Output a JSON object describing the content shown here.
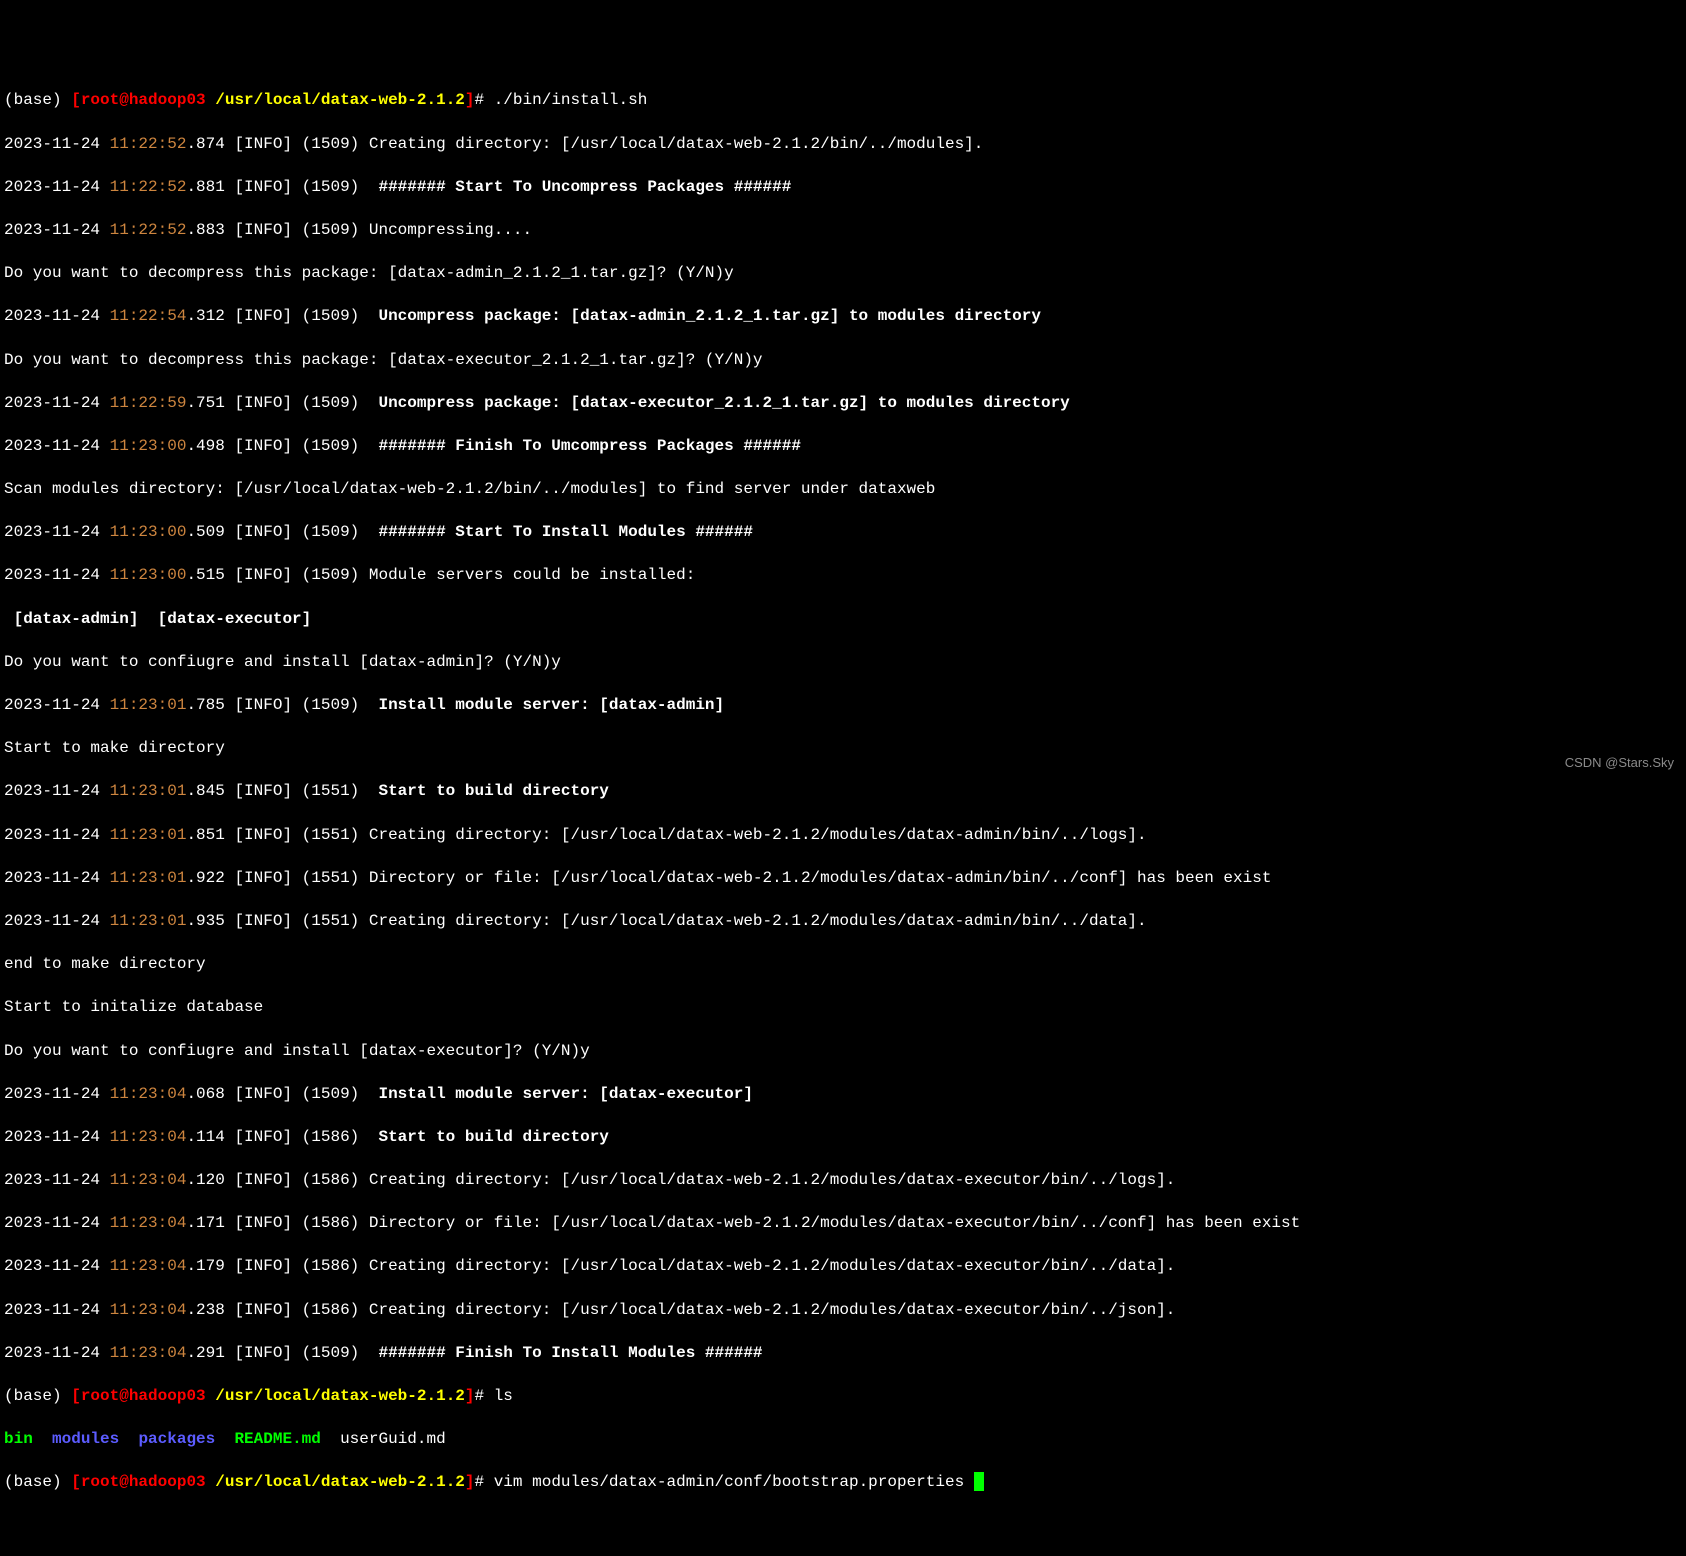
{
  "prompt1": {
    "env": "(base)",
    "usr": "[root@hadoop03 ",
    "path": "/usr/local/datax-web-2.1.2",
    "bracket": "]",
    "hash": "# ",
    "cmd": "./bin/install.sh"
  },
  "lines": {
    "l1_date": "2023-11-24",
    "l1_time": " 11:22:52",
    "l1_rest": ".874 [INFO] (1509) Creating directory: [/usr/local/datax-web-2.1.2/bin/../modules].",
    "l2_date": "2023-11-24",
    "l2_time": " 11:22:52",
    "l2_rest": ".881 [INFO] (1509)  ",
    "l2_bold": "####### Start To Uncompress Packages ######",
    "l3_date": "2023-11-24",
    "l3_time": " 11:22:52",
    "l3_rest": ".883 [INFO] (1509) Uncompressing....",
    "l4": "Do you want to decompress this package: [datax-admin_2.1.2_1.tar.gz]? (Y/N)y",
    "l5_date": "2023-11-24",
    "l5_time": " 11:22:54",
    "l5_rest": ".312 [INFO] (1509)  ",
    "l5_bold": "Uncompress package: [datax-admin_2.1.2_1.tar.gz] to modules directory",
    "l6": "Do you want to decompress this package: [datax-executor_2.1.2_1.tar.gz]? (Y/N)y",
    "l7_date": "2023-11-24",
    "l7_time": " 11:22:59",
    "l7_rest": ".751 [INFO] (1509)  ",
    "l7_bold": "Uncompress package: [datax-executor_2.1.2_1.tar.gz] to modules directory",
    "l8_date": "2023-11-24",
    "l8_time": " 11:23:00",
    "l8_rest": ".498 [INFO] (1509)  ",
    "l8_bold": "####### Finish To Umcompress Packages ######",
    "l9": "Scan modules directory: [/usr/local/datax-web-2.1.2/bin/../modules] to find server under dataxweb",
    "l10_date": "2023-11-24",
    "l10_time": " 11:23:00",
    "l10_rest": ".509 [INFO] (1509)  ",
    "l10_bold": "####### Start To Install Modules ######",
    "l11_date": "2023-11-24",
    "l11_time": " 11:23:00",
    "l11_rest": ".515 [INFO] (1509) Module servers could be installed:",
    "l12": " [datax-admin]  [datax-executor]",
    "l13": "Do you want to confiugre and install [datax-admin]? (Y/N)y",
    "l14_date": "2023-11-24",
    "l14_time": " 11:23:01",
    "l14_rest": ".785 [INFO] (1509)  ",
    "l14_bold": "Install module server: [datax-admin]",
    "l15": "Start to make directory",
    "l16_date": "2023-11-24",
    "l16_time": " 11:23:01",
    "l16_rest": ".845 [INFO] (1551)  ",
    "l16_bold": "Start to build directory",
    "l17_date": "2023-11-24",
    "l17_time": " 11:23:01",
    "l17_rest": ".851 [INFO] (1551) Creating directory: [/usr/local/datax-web-2.1.2/modules/datax-admin/bin/../logs].",
    "l18_date": "2023-11-24",
    "l18_time": " 11:23:01",
    "l18_rest": ".922 [INFO] (1551) Directory or file: [/usr/local/datax-web-2.1.2/modules/datax-admin/bin/../conf] has been exist",
    "l19_date": "2023-11-24",
    "l19_time": " 11:23:01",
    "l19_rest": ".935 [INFO] (1551) Creating directory: [/usr/local/datax-web-2.1.2/modules/datax-admin/bin/../data].",
    "l20": "end to make directory",
    "l21": "Start to initalize database",
    "l22": "Do you want to confiugre and install [datax-executor]? (Y/N)y",
    "l23_date": "2023-11-24",
    "l23_time": " 11:23:04",
    "l23_rest": ".068 [INFO] (1509)  ",
    "l23_bold": "Install module server: [datax-executor]",
    "l24_date": "2023-11-24",
    "l24_time": " 11:23:04",
    "l24_rest": ".114 [INFO] (1586)  ",
    "l24_bold": "Start to build directory",
    "l25_date": "2023-11-24",
    "l25_time": " 11:23:04",
    "l25_rest": ".120 [INFO] (1586) Creating directory: [/usr/local/datax-web-2.1.2/modules/datax-executor/bin/../logs].",
    "l26_date": "2023-11-24",
    "l26_time": " 11:23:04",
    "l26_rest": ".171 [INFO] (1586) Directory or file: [/usr/local/datax-web-2.1.2/modules/datax-executor/bin/../conf] has been exist",
    "l27_date": "2023-11-24",
    "l27_time": " 11:23:04",
    "l27_rest": ".179 [INFO] (1586) Creating directory: [/usr/local/datax-web-2.1.2/modules/datax-executor/bin/../data].",
    "l28_date": "2023-11-24",
    "l28_time": " 11:23:04",
    "l28_rest": ".238 [INFO] (1586) Creating directory: [/usr/local/datax-web-2.1.2/modules/datax-executor/bin/../json].",
    "l29_date": "2023-11-24",
    "l29_time": " 11:23:04",
    "l29_rest": ".291 [INFO] (1509)  ",
    "l29_bold": "####### Finish To Install Modules ######"
  },
  "prompt2": {
    "env": "(base)",
    "usr": "[root@hadoop03 ",
    "path": "/usr/local/datax-web-2.1.2",
    "bracket": "]",
    "hash": "# ",
    "cmd": "ls"
  },
  "ls": {
    "bin": "bin",
    "modules": "modules",
    "packages": "packages",
    "readme": "README.md",
    "userguid": "userGuid.md"
  },
  "prompt3": {
    "env": "(base)",
    "usr": "[root@hadoop03 ",
    "path": "/usr/local/datax-web-2.1.2",
    "bracket": "]",
    "hash": "# ",
    "cmd": "vim modules/datax-admin/conf/bootstrap.properties "
  },
  "watermark": "CSDN @Stars.Sky"
}
